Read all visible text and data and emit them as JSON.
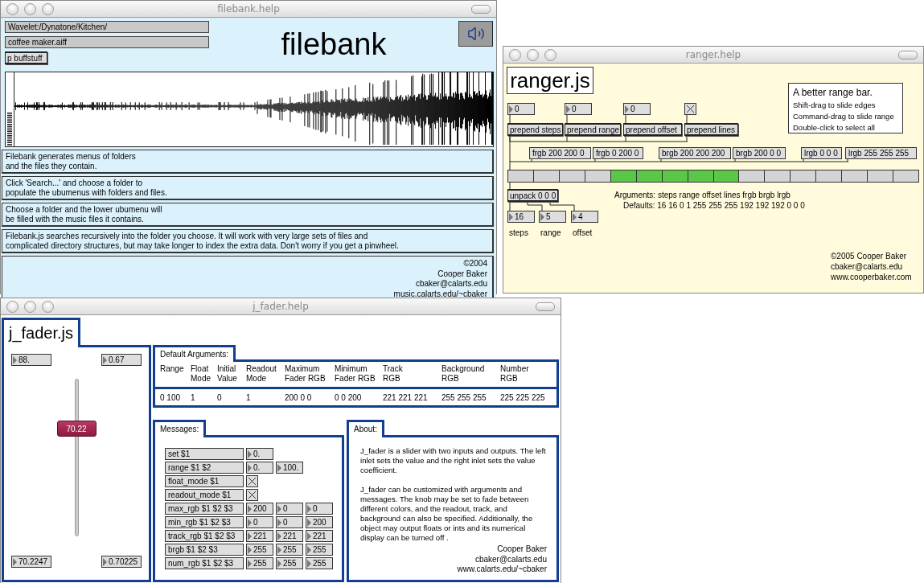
{
  "filebank": {
    "title": "filebank.help",
    "path_menu": "Wavelet:/Dynatone/Kitchen/",
    "file_menu": "coffee maker.aiff",
    "subpatch": "p buffstuff",
    "heading": "filebank",
    "notes": [
      "Filebank generates menus of folders\nand the files they contain.",
      "Click 'Search...' and choose a folder to\npopulate the ubumenus with folders and files.",
      "Choose a folder and the lower ubumenu will\nbe filled with the music files it contains.",
      "Filebank.js searches recursively into the folder you choose. It will work with very large sets of files and\ncomplicated directory structures, but may take longer to index the extra data. Don't worry if you get a pinwheel."
    ],
    "credits": [
      "©2004",
      "Cooper Baker",
      "cbaker@calarts.edu",
      "music.calarts.edu/~cbaker"
    ]
  },
  "ranger": {
    "title": "ranger.help",
    "heading": "ranger.js",
    "info": {
      "title": "A better range bar.",
      "lines": [
        "Shift-drag to slide edges",
        "Command-drag to slide range",
        "Double-click to select all"
      ]
    },
    "inputs": [
      {
        "kind": "number",
        "value": "0",
        "message": "prepend steps"
      },
      {
        "kind": "number",
        "value": "0",
        "message": "prepend range"
      },
      {
        "kind": "number",
        "value": "0",
        "message": "prepend offset"
      },
      {
        "kind": "toggle",
        "checked": true,
        "message": "prepend lines"
      }
    ],
    "color_messages": [
      "frgb 200 200 0",
      "frgb 0 200 0",
      "brgb 200 200 200",
      "brgb 200 0 0",
      "lrgb 0 0 0",
      "lrgb 255 255 255"
    ],
    "cells": [
      {
        "selected": false
      },
      {
        "selected": false
      },
      {
        "selected": false
      },
      {
        "selected": false
      },
      {
        "selected": true
      },
      {
        "selected": true
      },
      {
        "selected": true
      },
      {
        "selected": true
      },
      {
        "selected": true
      },
      {
        "selected": false
      },
      {
        "selected": false
      },
      {
        "selected": false
      },
      {
        "selected": false
      },
      {
        "selected": false
      },
      {
        "selected": false
      },
      {
        "selected": false
      }
    ],
    "unpack": "unpack 0 0 0",
    "outputs": [
      {
        "value": "16",
        "label": "steps"
      },
      {
        "value": "5",
        "label": "range"
      },
      {
        "value": "4",
        "label": "offset"
      }
    ],
    "arguments": "Arguments: steps range offset lines frgb brgb lrgb",
    "defaults": "Defaults: 16 16 0 1 255 255 255 192 192 192 0 0 0",
    "credits": [
      "©2005 Cooper Baker",
      "cbaker@calarts.edu",
      "www.cooperbaker.com"
    ]
  },
  "jfader": {
    "title": "j_fader.help",
    "heading": "j_fader.js",
    "top_numbers": [
      "88.",
      "0.67"
    ],
    "bottom_numbers": [
      "70.2247",
      "0.70225"
    ],
    "fader": {
      "level": 0.7022,
      "readout": "70.22"
    },
    "default_args": {
      "tab": "Default Arguments:",
      "columns": [
        "Range",
        "Float\nMode",
        "Initial\nValue",
        "Readout\nMode",
        "Maximum\nFader RGB",
        "Minimum\nFader RGB",
        "Track\nRGB",
        "Background\nRGB",
        "Number\nRGB"
      ],
      "values": [
        "0 100",
        "1",
        "0",
        "1",
        "200 0 0",
        "0 0 200",
        "221 221 221",
        "255 255 255",
        "225 225 225"
      ]
    },
    "messages": {
      "tab": "Messages:",
      "rows": [
        {
          "message": "set $1",
          "controls": [
            {
              "kind": "number",
              "value": "0."
            }
          ]
        },
        {
          "message": "range $1 $2",
          "controls": [
            {
              "kind": "number",
              "value": "0."
            },
            {
              "kind": "number",
              "value": "100."
            }
          ]
        },
        {
          "message": "float_mode $1",
          "controls": [
            {
              "kind": "toggle",
              "checked": true
            }
          ]
        },
        {
          "message": "readout_mode $1",
          "controls": [
            {
              "kind": "toggle",
              "checked": true
            }
          ]
        },
        {
          "message": "max_rgb $1 $2 $3",
          "controls": [
            {
              "kind": "number",
              "value": "200"
            },
            {
              "kind": "number",
              "value": "0"
            },
            {
              "kind": "number",
              "value": "0"
            }
          ]
        },
        {
          "message": "min_rgb $1 $2 $3",
          "controls": [
            {
              "kind": "number",
              "value": "0"
            },
            {
              "kind": "number",
              "value": "0"
            },
            {
              "kind": "number",
              "value": "200"
            }
          ]
        },
        {
          "message": "track_rgb $1 $2 $3",
          "controls": [
            {
              "kind": "number",
              "value": "221"
            },
            {
              "kind": "number",
              "value": "221"
            },
            {
              "kind": "number",
              "value": "221"
            }
          ]
        },
        {
          "message": "brgb $1 $2 $3",
          "controls": [
            {
              "kind": "number",
              "value": "255"
            },
            {
              "kind": "number",
              "value": "255"
            },
            {
              "kind": "number",
              "value": "255"
            }
          ]
        },
        {
          "message": "num_rgb $1 $2 $3",
          "controls": [
            {
              "kind": "number",
              "value": "255"
            },
            {
              "kind": "number",
              "value": "255"
            },
            {
              "kind": "number",
              "value": "255"
            }
          ]
        }
      ]
    },
    "about": {
      "tab": "About:",
      "paragraphs": [
        "J_fader is a slider with two inputs and outputs. The left inlet sets the value and the right inlet sets the value coefficient.",
        "J_fader can be customized with arguments and messages. The knob may be set to fade between different colors, and the readout, track, and background can also be specified. Additionally, the object may output floats or ints and its numerical display can be turned off ."
      ],
      "credits": [
        "Cooper Baker",
        "cbaker@calarts.edu",
        "www.calarts.edu/~cbaker"
      ]
    }
  }
}
